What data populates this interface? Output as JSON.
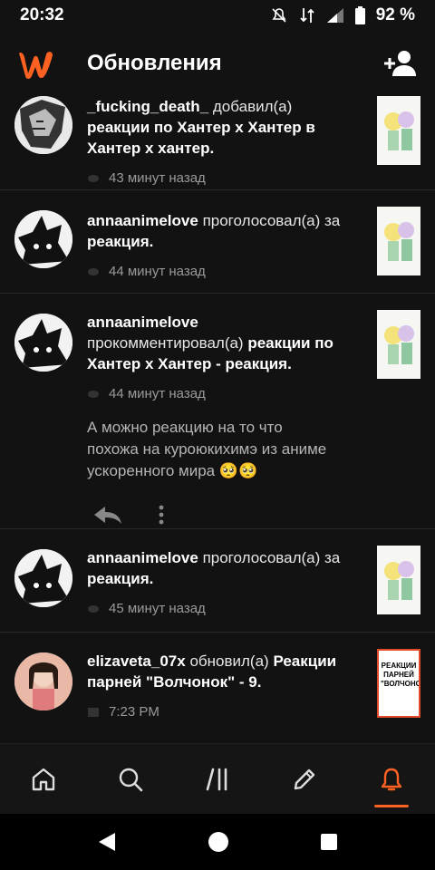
{
  "status_bar": {
    "time": "20:32",
    "battery": "92 %"
  },
  "header": {
    "title": "Обновления"
  },
  "feed": [
    {
      "user": "_fucking_death_",
      "action": "добавил(а)",
      "target": "реакции по Хантер х Хантер в Хантер х хантер.",
      "time": "43 минут назад"
    },
    {
      "user": "annaanimelove",
      "action": "проголосовал(а) за",
      "target": "реакция.",
      "time": "44 минут назад"
    },
    {
      "user": "annaanimelove",
      "action": "прокомментировал(а)",
      "target": "реакции по Хантер х Хантер - реакция.",
      "time": "44 минут назад",
      "comment": "А можно реакцию на то что похожа на куроюкихимэ из аниме ускоренного мира 🥺🥺"
    },
    {
      "user": "annaanimelove",
      "action": "проголосовал(а) за",
      "target": "реакция.",
      "time": "45 минут назад"
    },
    {
      "user": "elizaveta_07x",
      "action": "обновил(а)",
      "target": "Реакции парней \"Волчонок\" - 9.",
      "time": "7:23 PM",
      "cover_text": "РЕАКЦИИ ПАРНЕЙ \"ВОЛЧОНОК\""
    }
  ],
  "colors": {
    "accent": "#ff6122",
    "background": "#121212"
  },
  "icons": {
    "nav": [
      "home-icon",
      "search-icon",
      "library-icon",
      "write-icon",
      "notifications-icon"
    ]
  }
}
